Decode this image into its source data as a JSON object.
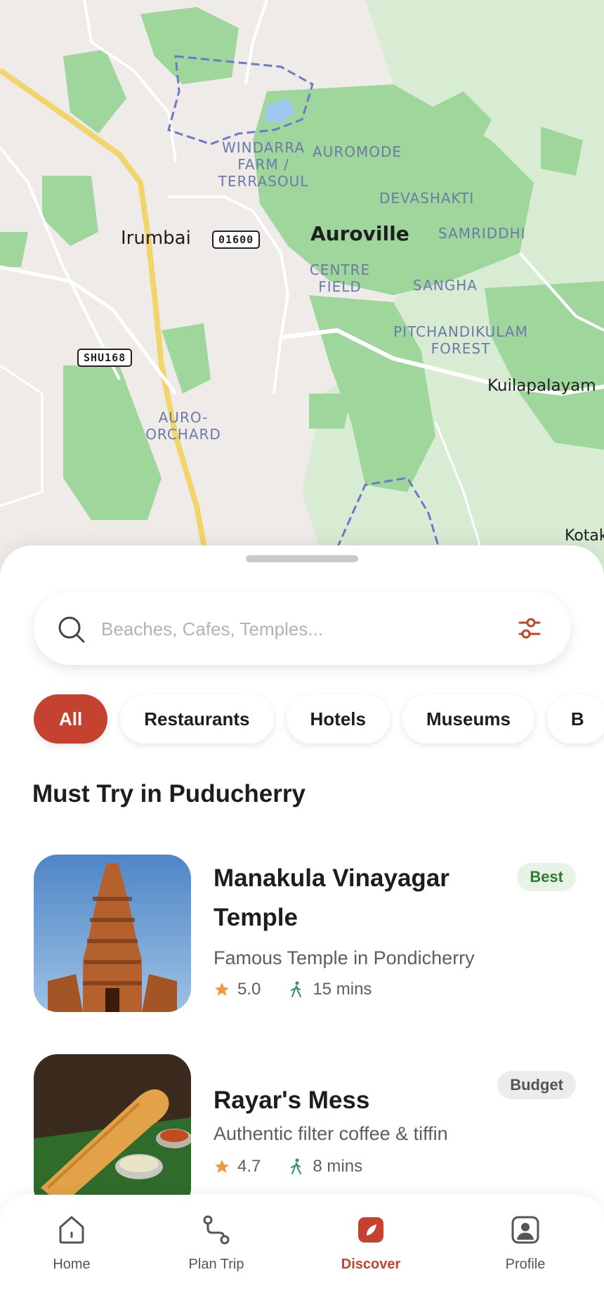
{
  "map": {
    "labels": {
      "windarra": "WINDARRA\nFARM /\nTERRASOUL",
      "auromode": "AUROMODE",
      "devashakti": "DEVASHAKTI",
      "samriddhi": "SAMRIDDHI",
      "centre_field": "CENTRE\nFIELD",
      "sangha": "SANGHA",
      "pitchandikulam": "PITCHANDIKULAM\nFOREST",
      "auro_orchard": "AURO-\nORCHARD"
    },
    "places": {
      "irumbai": "Irumbai",
      "auroville": "Auroville",
      "kuilapalayam": "Kuilapalayam",
      "kotak": "Kotak"
    },
    "roads": {
      "o1600": "01600",
      "shu168": "SHU168"
    }
  },
  "search": {
    "placeholder": "Beaches, Cafes, Temples..."
  },
  "chips": [
    "All",
    "Restaurants",
    "Hotels",
    "Museums",
    "B"
  ],
  "section_title": "Must Try in Puducherry",
  "cards": [
    {
      "title": "Manakula Vinayagar Temple",
      "subtitle": "Famous Temple in Pondicherry",
      "rating": "5.0",
      "walk": "15 mins",
      "badge": "Best"
    },
    {
      "title": "Rayar's Mess",
      "subtitle": "Authentic filter coffee & tiffin",
      "rating": "4.7",
      "walk": "8 mins",
      "badge": "Budget"
    }
  ],
  "nav": {
    "home": "Home",
    "plan_trip": "Plan Trip",
    "discover": "Discover",
    "profile": "Profile"
  },
  "colors": {
    "accent": "#c4422f",
    "best_badge": "#2e7d32",
    "map_green": "#9ad79a"
  },
  "icons": [
    "search-icon",
    "filter-icon",
    "star-icon",
    "walk-icon",
    "home-icon",
    "route-icon",
    "discover-icon",
    "profile-icon"
  ]
}
